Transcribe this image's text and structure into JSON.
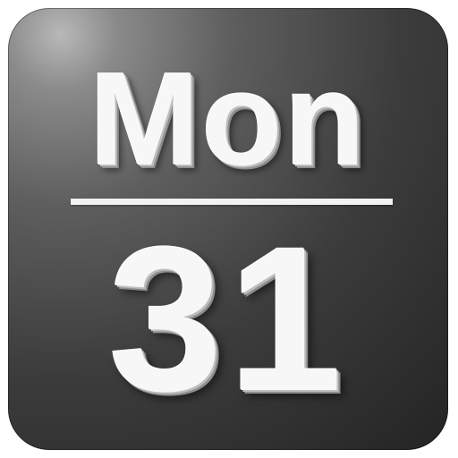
{
  "calendar_icon": {
    "day_of_week": "Mon",
    "day_of_month": "31"
  },
  "colors": {
    "background_light": "#b8b8b8",
    "background_dark": "#242424",
    "text": "#f7f7f7",
    "divider": "#f2f2f2"
  }
}
